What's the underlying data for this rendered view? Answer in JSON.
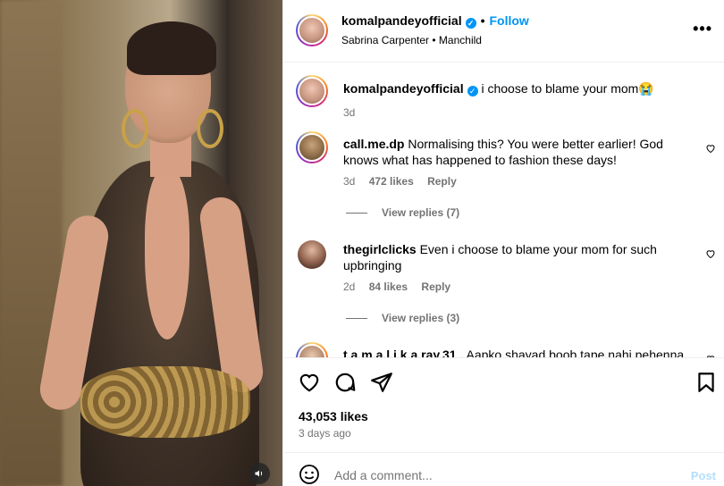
{
  "post": {
    "username": "komalpandeyofficial",
    "follow_label": "Follow",
    "audio": "Sabrina Carpenter • Manchild",
    "more_icon": "more-options-icon"
  },
  "caption": {
    "username": "komalpandeyofficial",
    "text": "i choose to blame your mom😭",
    "time": "3d"
  },
  "comments": [
    {
      "username": "call.me.dp",
      "text": "Normalising this? You were better earlier! God knows what has happened to fashion these days!",
      "time": "3d",
      "likes": "472 likes",
      "reply_label": "Reply",
      "view_replies": "View replies (7)"
    },
    {
      "username": "thegirlclicks",
      "text": "Even i choose to blame your mom for such upbringing",
      "time": "2d",
      "likes": "84 likes",
      "reply_label": "Reply",
      "view_replies": "View replies (3)"
    },
    {
      "username": "t.a.m.a.l.i.k.a.ray.31 .",
      "text": "Aapko shayad boob tape nahi pehenna"
    }
  ],
  "actions": {
    "likes": "43,053 likes",
    "posted": "3 days ago"
  },
  "composer": {
    "placeholder": "Add a comment...",
    "post_label": "Post"
  },
  "colors": {
    "accent": "#0095f6",
    "muted": "#737373",
    "border": "#efefef"
  }
}
